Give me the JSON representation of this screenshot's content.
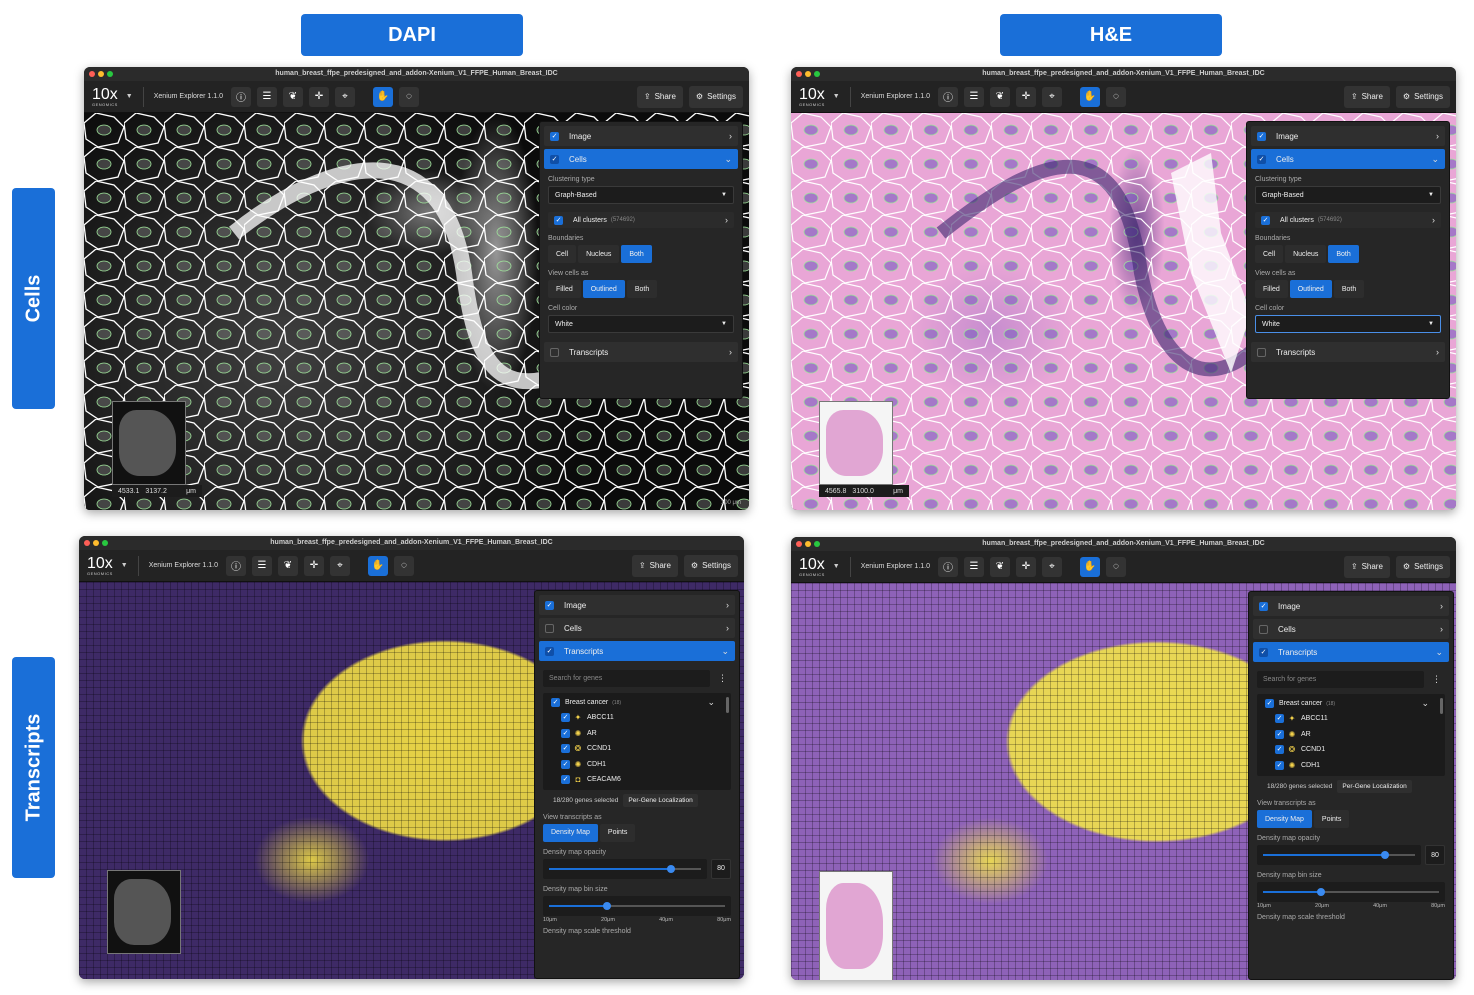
{
  "headers": {
    "col1": "DAPI",
    "col2": "H&E",
    "row1": "Cells",
    "row2": "Transcripts"
  },
  "window_title": "human_breast_ffpe_predesigned_and_addon-Xenium_V1_FFPE_Human_Breast_IDC",
  "logo": {
    "main": "10x",
    "sub": "GENOMICS"
  },
  "app_name": "Xenium Explorer 1.1.0",
  "toolbar": {
    "share": "Share",
    "settings": "Settings"
  },
  "layers": {
    "image": "Image",
    "cells": "Cells",
    "transcripts": "Transcripts"
  },
  "cells_panel": {
    "clustering_label": "Clustering type",
    "clustering_value": "Graph-Based",
    "all_clusters": "All clusters",
    "all_clusters_count": "(574692)",
    "boundaries_label": "Boundaries",
    "boundaries_options": [
      "Cell",
      "Nucleus",
      "Both"
    ],
    "boundaries_selected": "Both",
    "view_cells_label": "View cells as",
    "view_cells_options": [
      "Filled",
      "Outlined",
      "Both"
    ],
    "view_cells_selected": "Outlined",
    "cell_color_label": "Cell color",
    "cell_color_value": "White"
  },
  "transcripts_panel": {
    "search_placeholder": "Search for genes",
    "gene_group": "Breast cancer",
    "gene_group_count": "(18)",
    "genes": [
      {
        "name": "ABCC11",
        "icon": "sparkle"
      },
      {
        "name": "AR",
        "icon": "sun"
      },
      {
        "name": "CCND1",
        "icon": "ring"
      },
      {
        "name": "CDH1",
        "icon": "sun"
      },
      {
        "name": "CEACAM6",
        "icon": "square"
      }
    ],
    "genes_selected": "18/280 genes selected",
    "per_gene_button": "Per-Gene Localization",
    "view_as_label": "View transcripts as",
    "view_as_options": [
      "Density Map",
      "Points"
    ],
    "view_as_selected": "Density Map",
    "opacity_label": "Density map opacity",
    "opacity_value": "80",
    "bin_size_label": "Density map bin size",
    "bin_ticks": [
      "10μm",
      "20μm",
      "40μm",
      "80μm"
    ],
    "threshold_label": "Density map scale threshold"
  },
  "coords": {
    "dapi": {
      "x": "4533.1",
      "y": "3137.2",
      "unit": "μm"
    },
    "he": {
      "x": "4565.8",
      "y": "3100.0",
      "unit": "μm"
    }
  },
  "scale_bar": "100 μm",
  "colors": {
    "accent": "#1a6fd8",
    "panel": "#262626",
    "density_yellow": "#e6d245"
  }
}
